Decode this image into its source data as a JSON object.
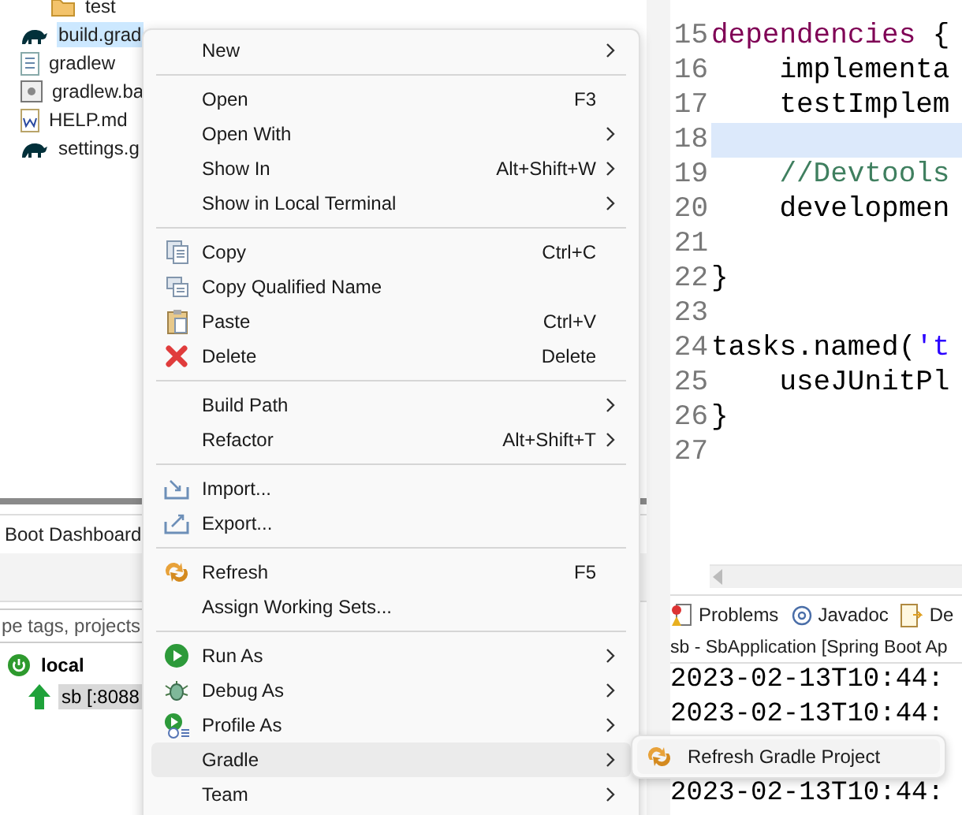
{
  "explorer": {
    "items": [
      {
        "label": "test",
        "kind": "folder",
        "selected": false
      },
      {
        "label": "build.grad",
        "kind": "gradle",
        "selected": true
      },
      {
        "label": "gradlew",
        "kind": "file",
        "selected": false
      },
      {
        "label": "gradlew.ba",
        "kind": "batch",
        "selected": false
      },
      {
        "label": "HELP.md",
        "kind": "word",
        "selected": false
      },
      {
        "label": "settings.g",
        "kind": "gradle",
        "selected": false
      }
    ]
  },
  "boot_dashboard": {
    "tab": "Boot Dashboard",
    "filter_placeholder": "pe tags, projects",
    "tree": [
      {
        "label": "local",
        "kind": "power",
        "selected": false,
        "children": [
          {
            "label": "sb [:8088",
            "kind": "up",
            "selected": true
          }
        ]
      }
    ]
  },
  "editor": {
    "lines": [
      {
        "number": "15",
        "highlighted": false,
        "tokens": [
          {
            "kind": "keyword",
            "text": "dependencies"
          },
          {
            "kind": "plain",
            "text": " {"
          }
        ]
      },
      {
        "number": "16",
        "highlighted": false,
        "tokens": [
          {
            "kind": "plain",
            "text": "    implementa"
          }
        ]
      },
      {
        "number": "17",
        "highlighted": false,
        "tokens": [
          {
            "kind": "plain",
            "text": "    testImplem"
          }
        ]
      },
      {
        "number": "18",
        "highlighted": true
      },
      {
        "number": "19",
        "highlighted": false,
        "tokens": [
          {
            "kind": "comment",
            "text": "    //Devtools"
          }
        ]
      },
      {
        "number": "20",
        "highlighted": false,
        "tokens": [
          {
            "kind": "plain",
            "text": "    developmen"
          }
        ]
      },
      {
        "number": "21",
        "highlighted": false
      },
      {
        "number": "22",
        "highlighted": false,
        "tokens": [
          {
            "kind": "plain",
            "text": "}"
          }
        ]
      },
      {
        "number": "23",
        "highlighted": false
      },
      {
        "number": "24",
        "highlighted": false,
        "tokens": [
          {
            "kind": "plain",
            "text": "tasks.named("
          },
          {
            "kind": "string",
            "text": "'t"
          }
        ]
      },
      {
        "number": "25",
        "highlighted": false,
        "tokens": [
          {
            "kind": "plain",
            "text": "    useJUnitPl"
          }
        ]
      },
      {
        "number": "26",
        "highlighted": false,
        "tokens": [
          {
            "kind": "plain",
            "text": "}"
          }
        ]
      },
      {
        "number": "27",
        "highlighted": false
      }
    ]
  },
  "bottom_tabs": [
    {
      "label": "Problems",
      "kind": "problems"
    },
    {
      "label": "Javadoc",
      "kind": "javadoc"
    },
    {
      "label": "De",
      "kind": "declaration"
    }
  ],
  "console": {
    "title": "sb - SbApplication [Spring Boot Ap",
    "lines": [
      "2023-02-13T10:44:",
      "2023-02-13T10:44:",
      "2023-02-13T10:44:"
    ]
  },
  "context_menu": {
    "groups": [
      [
        {
          "label": "New",
          "kind": "none",
          "submenu": true,
          "selected": false
        }
      ],
      [
        {
          "label": "Open",
          "shortcut": "F3",
          "kind": "none",
          "submenu": false,
          "selected": false
        },
        {
          "label": "Open With",
          "kind": "none",
          "submenu": true,
          "selected": false
        },
        {
          "label": "Show In",
          "shortcut": "Alt+Shift+W",
          "kind": "none",
          "submenu": true,
          "selected": false
        },
        {
          "label": "Show in Local Terminal",
          "kind": "none",
          "submenu": true,
          "selected": false
        }
      ],
      [
        {
          "label": "Copy",
          "shortcut": "Ctrl+C",
          "kind": "copy",
          "submenu": false,
          "selected": false
        },
        {
          "label": "Copy Qualified Name",
          "kind": "copy-name",
          "submenu": false,
          "selected": false
        },
        {
          "label": "Paste",
          "shortcut": "Ctrl+V",
          "kind": "paste",
          "submenu": false,
          "selected": false
        },
        {
          "label": "Delete",
          "shortcut": "Delete",
          "kind": "delete",
          "submenu": false,
          "selected": false
        }
      ],
      [
        {
          "label": "Build Path",
          "kind": "none",
          "submenu": true,
          "selected": false
        },
        {
          "label": "Refactor",
          "shortcut": "Alt+Shift+T",
          "kind": "none",
          "submenu": true,
          "selected": false
        }
      ],
      [
        {
          "label": "Import...",
          "kind": "import",
          "submenu": false,
          "selected": false
        },
        {
          "label": "Export...",
          "kind": "export",
          "submenu": false,
          "selected": false
        }
      ],
      [
        {
          "label": "Refresh",
          "shortcut": "F5",
          "kind": "refresh",
          "submenu": false,
          "selected": false
        },
        {
          "label": "Assign Working Sets...",
          "kind": "none",
          "submenu": false,
          "selected": false
        }
      ],
      [
        {
          "label": "Run As",
          "kind": "run",
          "submenu": true,
          "selected": false
        },
        {
          "label": "Debug As",
          "kind": "debug",
          "submenu": true,
          "selected": false
        },
        {
          "label": "Profile As",
          "kind": "profile",
          "submenu": true,
          "selected": false
        },
        {
          "label": "Gradle",
          "kind": "none",
          "submenu": true,
          "selected": true
        },
        {
          "label": "Team",
          "kind": "none",
          "submenu": true,
          "selected": false
        }
      ]
    ]
  },
  "submenu": {
    "items": [
      {
        "label": "Refresh Gradle Project",
        "kind": "refresh"
      }
    ]
  }
}
